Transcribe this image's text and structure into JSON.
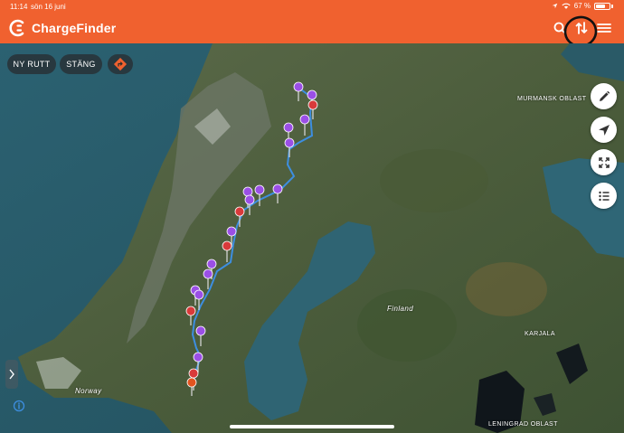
{
  "status_bar": {
    "time": "11:14",
    "date": "sön 16 juni",
    "battery": "67 %"
  },
  "header": {
    "title": "ChargeFinder",
    "icons": [
      "search-icon",
      "routes-icon",
      "menu-icon"
    ],
    "brand_color": "#f0612f"
  },
  "toolbar": {
    "new_route_label": "NY RUTT",
    "close_label": "STÄNG",
    "directions_icon": "turn-right-icon"
  },
  "side_buttons": [
    "pencil-icon",
    "navigation-arrow-icon",
    "fullscreen-icon",
    "list-icon"
  ],
  "map": {
    "labels": {
      "norway": "Norway",
      "finland": "Finland",
      "murmansk": "MURMANSK OBLAST",
      "karjala": "KARJALA",
      "leningrad": "LENINGRAD OBLAST"
    },
    "route_color": "#3d8ee0",
    "pin_colors": {
      "available": "#9b4fe6",
      "busy": "#d93a3a"
    }
  }
}
